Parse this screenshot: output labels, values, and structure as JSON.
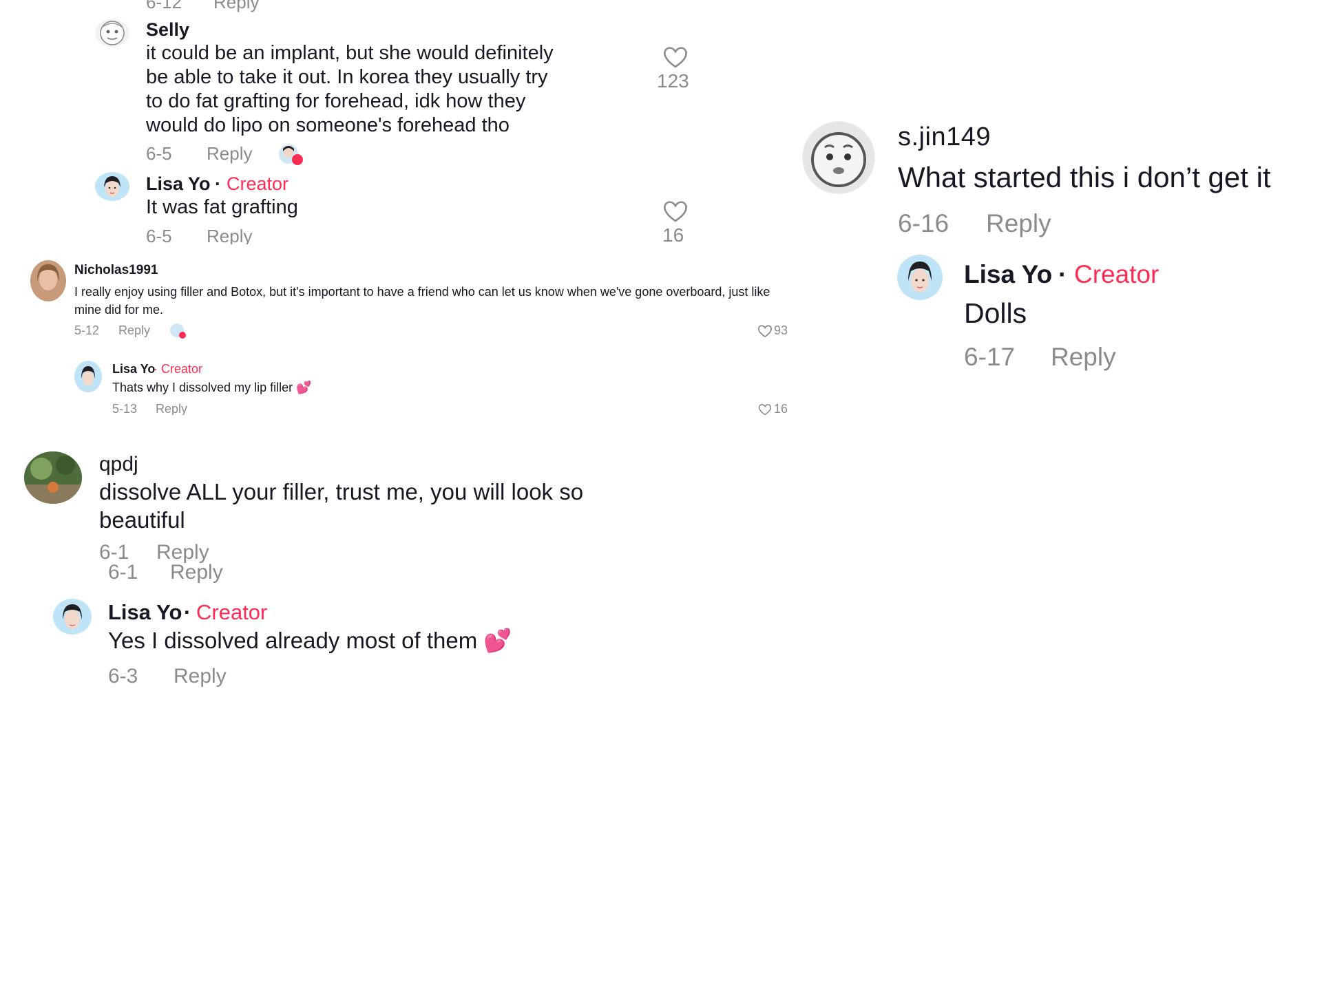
{
  "panel1": {
    "top_cut_meta": {
      "date": "6-12",
      "reply": "Reply"
    },
    "comment": {
      "username": "Selly",
      "text_lines": [
        "it could be an implant, but she would definitely",
        "be able to take it out. In korea they usually try",
        "to do fat grafting for forehead, idk how they",
        "would do lipo on someone's forehead tho"
      ],
      "date": "6-5",
      "reply": "Reply",
      "likes": "123"
    },
    "reply": {
      "username": "Lisa Yo",
      "separator": "·",
      "badge": "Creator",
      "text": "It was fat grafting",
      "date": "6-5",
      "reply": "Reply",
      "likes": "16"
    }
  },
  "panel2": {
    "comment": {
      "username": "Nicholas1991",
      "text_lines": [
        "I really enjoy using filler and Botox, but it's important to have a friend who can let us know when we've gone overboard, just like",
        "mine did for me."
      ],
      "date": "5-12",
      "reply": "Reply",
      "likes": "93"
    },
    "reply": {
      "username": "Lisa Yo",
      "separator": "·",
      "badge": "Creator",
      "text": "Thats why I dissolved my lip filler",
      "emoji": "💕",
      "date": "5-13",
      "reply": "Reply",
      "likes": "16"
    }
  },
  "panel3": {
    "comment": {
      "username": "s.jin149",
      "text": "What started this i don’t get it",
      "date": "6-16",
      "reply": "Reply"
    },
    "reply": {
      "username": "Lisa Yo",
      "separator": "·",
      "badge": "Creator",
      "text": "Dolls",
      "date": "6-17",
      "reply": "Reply"
    }
  },
  "panel4": {
    "comment": {
      "username": "qpdj",
      "text_lines": [
        "dissolve ALL your filler, trust me, you will look so",
        "beautiful"
      ],
      "date": "6-1",
      "reply": "Reply"
    },
    "dup_meta": {
      "date": "6-1",
      "reply": "Reply"
    },
    "reply": {
      "username": "Lisa Yo",
      "separator": "·",
      "badge": "Creator",
      "text": "Yes I dissolved already most of them",
      "emoji": "💕",
      "date": "6-3",
      "reply": "Reply"
    }
  },
  "colors": {
    "creator": "#fe2c55",
    "meta": "#8a8b91",
    "text": "#161823"
  }
}
